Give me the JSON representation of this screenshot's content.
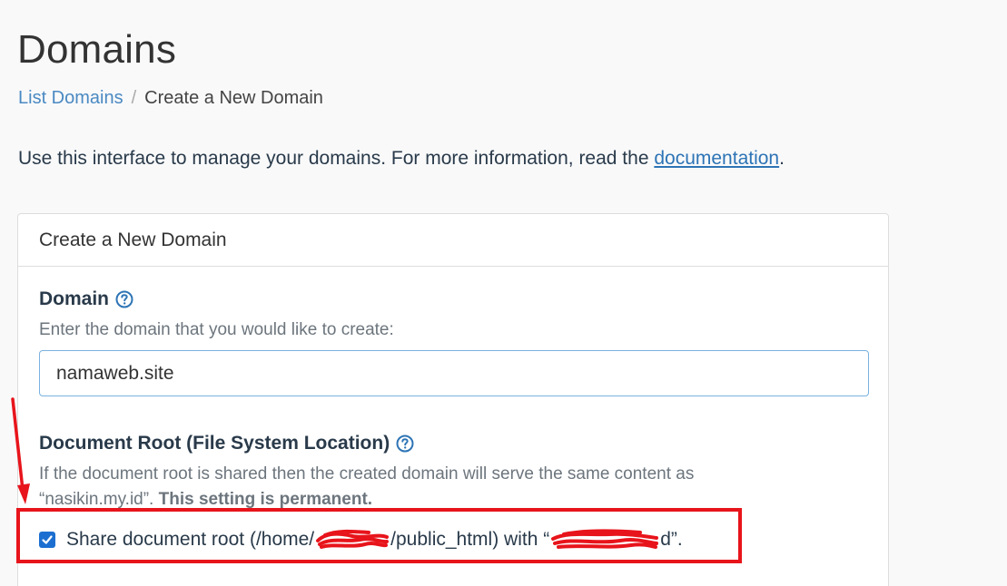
{
  "page": {
    "title": "Domains"
  },
  "breadcrumb": {
    "link": "List Domains",
    "separator": "/",
    "current": "Create a New Domain"
  },
  "intro": {
    "text": "Use this interface to manage your domains. For more information, read the ",
    "link": "documentation",
    "end": "."
  },
  "panel": {
    "heading": "Create a New Domain",
    "domain": {
      "label": "Domain",
      "help": "Enter the domain that you would like to create:",
      "value": "namaweb.site"
    },
    "docroot": {
      "label": "Document Root (File System Location)",
      "help_line1": "If the document root is shared then the created domain will serve the same content as",
      "help_line2_prefix": "“nasikin.my.id”. ",
      "help_line2_bold": "This setting is permanent.",
      "checkbox_prefix": "Share document root (/home/",
      "checkbox_middle": "/public_html) with “",
      "checkbox_suffix": "d”.",
      "checked": true
    }
  },
  "annotation": {
    "color": "#e8141b"
  },
  "icons": {
    "help": "question-circle-icon",
    "check": "check-icon",
    "arrow": "red-arrow-annotation"
  }
}
